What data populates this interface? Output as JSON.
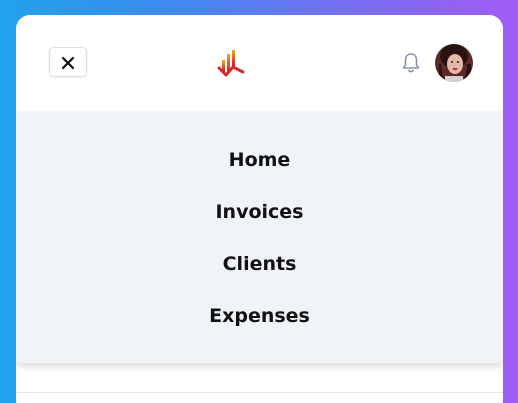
{
  "header": {
    "close_icon": "close-icon",
    "logo_icon": "brand-logo-icon",
    "notification_icon": "bell-icon",
    "avatar_icon": "user-avatar"
  },
  "menu": {
    "items": [
      {
        "label": "Home"
      },
      {
        "label": "Invoices"
      },
      {
        "label": "Clients"
      },
      {
        "label": "Expenses"
      }
    ]
  },
  "colors": {
    "background_gradient_start": "#1fa3ec",
    "background_gradient_end": "#a05cf7",
    "menu_background": "#f0f3f8",
    "logo_red": "#e0342b",
    "logo_orange": "#f5a623",
    "bell_gray": "#8a94a6"
  }
}
